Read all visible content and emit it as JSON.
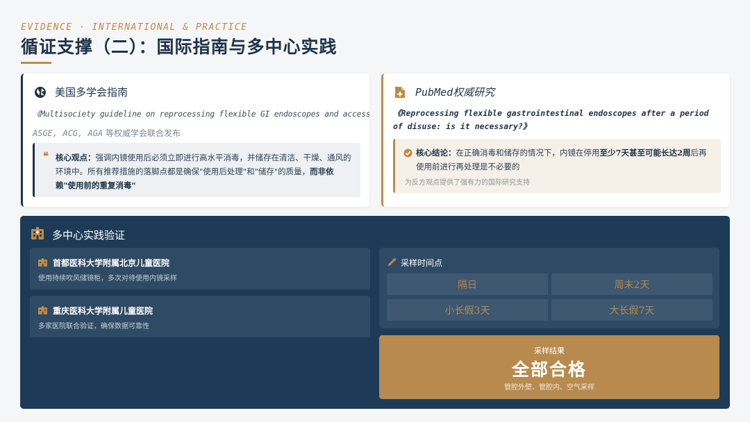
{
  "header": {
    "kicker": "EVIDENCE · INTERNATIONAL & PRACTICE",
    "title": "循证支撑（二）：国际指南与多中心实践"
  },
  "guideline_card": {
    "icon": "globe-icon",
    "title": "美国多学会指南",
    "citation": "《Multisociety guideline on reprocessing flexible GI endoscopes and accessories》",
    "orgs_abbr": "ASGE, ACG, AGA",
    "orgs_suffix": " 等权威学会联合发布",
    "quote_label": "核心观点：",
    "quote_text": "强调内镜使用后必须立即进行高水平消毒，并储存在清洁、干燥、通风的环境中。所有推荐措施的落脚点都是确保\"使用后处理\"和\"储存\"的质量，",
    "quote_bold": "而非依赖\"使用前的重复消毒\""
  },
  "pubmed_card": {
    "icon": "document-medical-icon",
    "title": "PubMed权威研究",
    "citation": "《Reprocessing flexible gastrointestinal endoscopes after a period of disuse: is it necessary?》",
    "conclusion_label": "核心结论：",
    "conclusion_pre": "在正确消毒和储存的情况下，内镜在停用",
    "conclusion_bold": "至少7天甚至可能长达2周",
    "conclusion_post": "后再使用前进行再处理是不必要的",
    "note": "为反方观点提供了强有力的国际研究支持"
  },
  "practice_panel": {
    "icon": "hospital-building-icon",
    "title": "多中心实践验证",
    "hospitals": [
      {
        "name": "首都医科大学附属北京儿童医院",
        "desc": "使用持续吹风储镜柜，多次对待使用内镜采样"
      },
      {
        "name": "重庆医科大学附属儿童医院",
        "desc": "多家医院联合验证，确保数据可靠性"
      }
    ],
    "sampling": {
      "title": "采样时间点",
      "points": [
        "隔日",
        "周末2天",
        "小长假3天",
        "大长假7天"
      ]
    },
    "result": {
      "caption": "采样结果",
      "headline": "全部合格",
      "detail": "管腔外壁、管腔内、空气采样"
    }
  },
  "colors": {
    "navy": "#1d3b57",
    "gold": "#b88a4e",
    "accent": "#c08a45"
  }
}
